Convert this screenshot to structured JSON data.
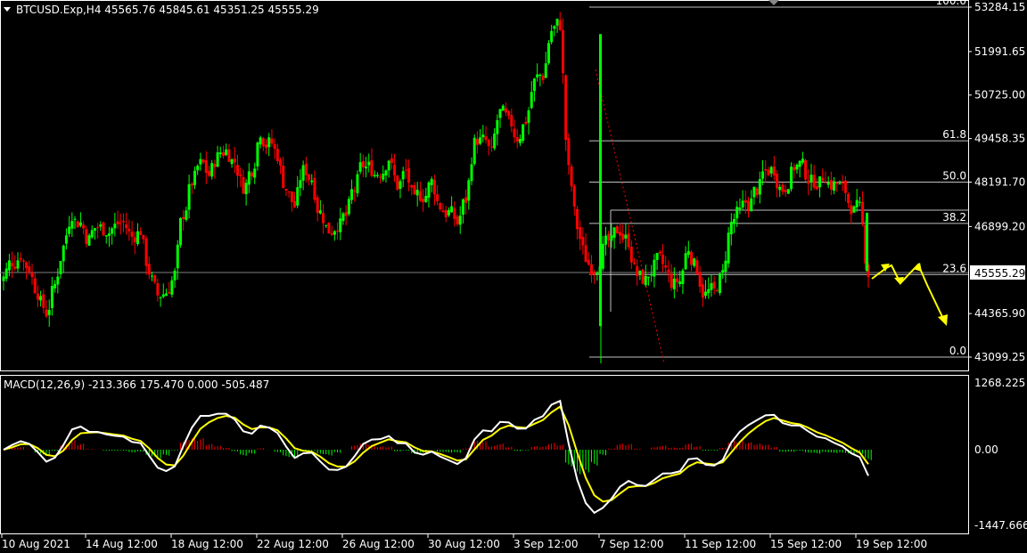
{
  "header": {
    "symbol_line": "BTCUSD.Exp,H4  45565.76 45845.61 45351.25 45555.29"
  },
  "macd": {
    "label": "MACD(12,26,9) -213.366 175.470 0.000 -505.487",
    "axis_labels": [
      "1268.225",
      "0.00",
      "-1447.666"
    ]
  },
  "colors": {
    "background": "#000000",
    "bull": "#00ff00",
    "bear": "#ff0000",
    "fib": "#c0c0c0",
    "arrow": "#ffff00",
    "signal": "#ffff00",
    "macd_line": "#ffffff",
    "hist_pos": "#ff0000",
    "hist_neg": "#00ff00"
  },
  "chart_data": {
    "type": "candlestick",
    "symbol": "BTCUSD.Exp",
    "timeframe": "H4",
    "current_price": "45555.29",
    "price_axis_labels": [
      "53284.15",
      "51991.65",
      "50725.00",
      "49458.35",
      "48191.70",
      "46899.20",
      "45555.29",
      "44365.90",
      "43099.25"
    ],
    "ylim": [
      43099.25,
      53284.15
    ],
    "x_tick_labels": [
      "10 Aug 2021",
      "14 Aug 12:00",
      "18 Aug 12:00",
      "22 Aug 12:00",
      "26 Aug 12:00",
      "30 Aug 12:00",
      "3 Sep 12:00",
      "7 Sep 12:00",
      "11 Sep 12:00",
      "15 Sep 12:00",
      "19 Sep 12:00"
    ],
    "fibonacci": {
      "high": 53284.15,
      "low": 43099.25,
      "levels": [
        "100.0",
        "61.8",
        "50.0",
        "38.2",
        "23.6",
        "0.0"
      ]
    },
    "close_path": [
      45400,
      45900,
      46100,
      45700,
      45000,
      44400,
      45200,
      46300,
      47300,
      47000,
      46500,
      46900,
      46800,
      46900,
      47000,
      46600,
      46800,
      45600,
      44900,
      45000,
      45500,
      47300,
      48200,
      48700,
      48400,
      48900,
      49100,
      48800,
      48100,
      48600,
      49700,
      49300,
      49000,
      48000,
      47500,
      48500,
      48300,
      47300,
      46800,
      47000,
      47200,
      48000,
      48700,
      48600,
      48500,
      48900,
      48100,
      48500,
      47600,
      47800,
      48200,
      47500,
      47300,
      47000,
      47700,
      49300,
      49400,
      49000,
      50200,
      49900,
      49500,
      50000,
      51100,
      51300,
      52600,
      52800,
      48500,
      46900,
      46000,
      45700,
      46200,
      46400,
      46800,
      46500,
      45500,
      45300,
      45700,
      45800,
      45300,
      45300,
      46300,
      45700,
      44900,
      45000,
      45500,
      47000,
      47300,
      47600,
      48000,
      48500,
      48600,
      48000,
      48400,
      48700,
      48300,
      48200,
      48400,
      48100,
      48000,
      47500,
      47400,
      45556
    ],
    "forecast_arrows": "yellow projected zigzag then decline"
  }
}
